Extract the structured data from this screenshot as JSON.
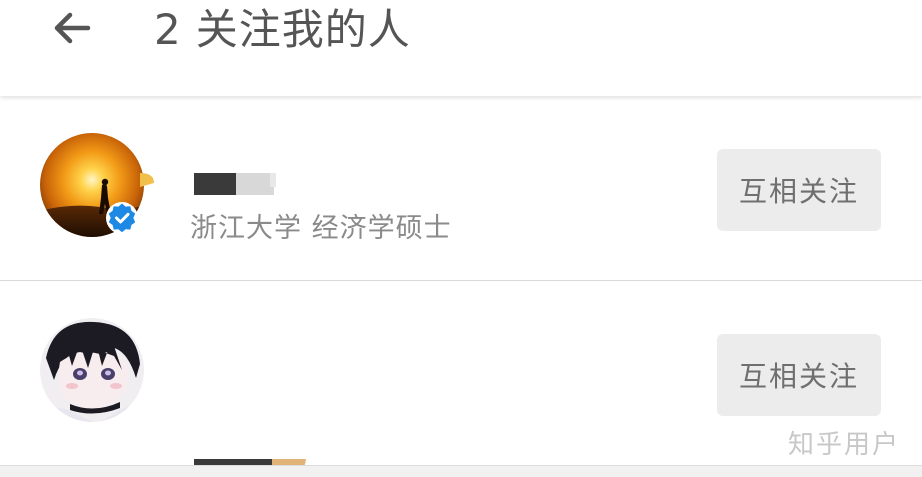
{
  "header": {
    "back_icon": "arrow-left-icon",
    "title_count": "2",
    "title_text": "关注我的人"
  },
  "users": [
    {
      "name": "",
      "subtitle": "浙江大学 经济学硕士",
      "verified": true,
      "verified_icon": "verified-check-icon",
      "follow_label": "互相关注"
    },
    {
      "name": "",
      "subtitle": "",
      "verified": false,
      "follow_label": "互相关注"
    }
  ],
  "watermark": "知乎用户",
  "colors": {
    "verified_blue": "#1e88e5",
    "button_bg": "#ececec",
    "button_text": "#6f6f6f",
    "title_text": "#555555",
    "subtitle_text": "#8a8a8a"
  }
}
